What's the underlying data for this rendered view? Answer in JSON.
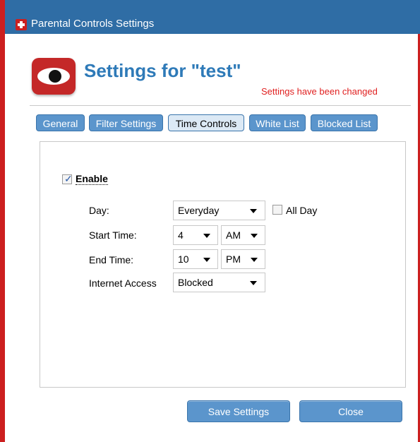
{
  "window": {
    "title": "Parental Controls Settings"
  },
  "header": {
    "title": "Settings for \"test\"",
    "status": "Settings have been changed"
  },
  "tabs": [
    {
      "label": "General"
    },
    {
      "label": "Filter Settings"
    },
    {
      "label": "Time Controls",
      "active": true
    },
    {
      "label": "White List"
    },
    {
      "label": "Blocked List"
    }
  ],
  "time_controls": {
    "enable": {
      "label": "Enable",
      "checked": true
    },
    "day": {
      "label": "Day:",
      "value": "Everyday"
    },
    "all_day": {
      "label": "All Day",
      "checked": false
    },
    "start_time": {
      "label": "Start Time:",
      "hour": "4",
      "ampm": "AM"
    },
    "end_time": {
      "label": "End Time:",
      "hour": "10",
      "ampm": "PM"
    },
    "internet_access": {
      "label": "Internet Access",
      "value": "Blocked"
    }
  },
  "buttons": {
    "save": "Save Settings",
    "close": "Close"
  },
  "colors": {
    "accent": "#2e7ab8",
    "tab": "#5b95cc",
    "status": "#e02020",
    "frame": "#cc1f1f",
    "titlebar": "#2f6da5"
  },
  "icons": {
    "app": "red-cross-shield-icon",
    "logo": "red-eye-logo-icon"
  }
}
